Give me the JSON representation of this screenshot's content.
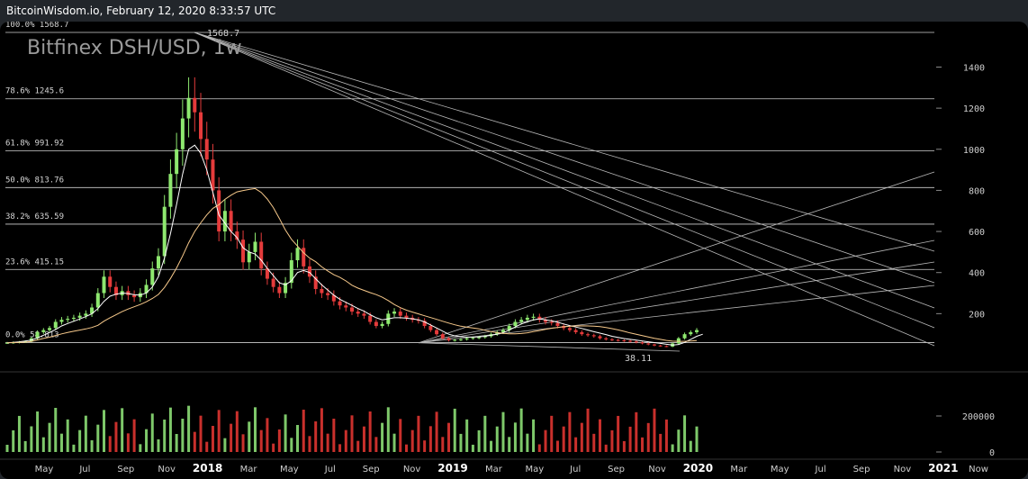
{
  "header": {
    "title": "BitcoinWisdom.io, February 12, 2020 8:33:57 UTC"
  },
  "colors": {
    "up": "#8ee86f",
    "down": "#e53b3b",
    "ema_fast": "#ffffff",
    "ema_slow": "#f7c98b",
    "grid": "#cfcfcf",
    "fan": "#b8b8b8",
    "volume_up": "#7ec86a",
    "volume_down": "#c9302c"
  },
  "chart_data": {
    "type": "candlestick",
    "title": "Bitfinex DSH/USD, 1w",
    "x_ticks": [
      "May",
      "Jul",
      "Sep",
      "Nov",
      "2018",
      "Mar",
      "May",
      "Jul",
      "Sep",
      "Nov",
      "2019",
      "Mar",
      "May",
      "Jul",
      "Sep",
      "Nov",
      "2020",
      "Mar",
      "May",
      "Jul",
      "Sep",
      "Nov",
      "2021",
      "Now"
    ],
    "x_ticks_bold": [
      "2018",
      "2019",
      "2020",
      "2021"
    ],
    "price_axis": {
      "ticks": [
        1400,
        1200,
        1000,
        800,
        600,
        400,
        200
      ],
      "range": [
        0,
        1568.7
      ]
    },
    "volume_axis": {
      "ticks": [
        200000,
        0
      ],
      "labels": [
        "200000",
        "0"
      ]
    },
    "fib_levels": [
      {
        "label": "100.0% 1568.7",
        "value": 1568.7
      },
      {
        "label": "78.6% 1245.6",
        "value": 1245.6
      },
      {
        "label": "61.8% 991.92",
        "value": 991.92
      },
      {
        "label": "50.0% 813.76",
        "value": 813.76
      },
      {
        "label": "38.2% 635.59",
        "value": 635.59
      },
      {
        "label": "23.6% 415.15",
        "value": 415.15
      },
      {
        "label": "0.0% 58.813",
        "value": 58.813
      }
    ],
    "annotations": {
      "high": "1568.7",
      "low": "38.11"
    },
    "close_series": [
      58,
      60,
      62,
      65,
      80,
      110,
      120,
      130,
      160,
      170,
      175,
      180,
      190,
      200,
      230,
      300,
      380,
      330,
      290,
      310,
      290,
      280,
      300,
      340,
      420,
      480,
      720,
      880,
      1000,
      1150,
      1250,
      1180,
      1050,
      950,
      800,
      600,
      700,
      600,
      560,
      450,
      500,
      550,
      420,
      370,
      330,
      300,
      350,
      460,
      520,
      430,
      380,
      320,
      300,
      290,
      260,
      240,
      230,
      210,
      200,
      190,
      160,
      140,
      150,
      200,
      210,
      190,
      180,
      170,
      165,
      140,
      120,
      100,
      80,
      70,
      72,
      75,
      80,
      82,
      85,
      90,
      100,
      110,
      120,
      140,
      160,
      170,
      180,
      185,
      170,
      160,
      155,
      140,
      130,
      120,
      110,
      100,
      95,
      90,
      80,
      75,
      72,
      70,
      68,
      65,
      60,
      55,
      50,
      45,
      42,
      40,
      55,
      80,
      100,
      110,
      120
    ],
    "ema_fast": [
      58,
      60,
      63,
      67,
      72,
      82,
      95,
      108,
      123,
      140,
      152,
      163,
      174,
      186,
      200,
      225,
      260,
      285,
      295,
      300,
      298,
      292,
      290,
      300,
      330,
      380,
      470,
      590,
      730,
      880,
      1000,
      1020,
      980,
      900,
      790,
      680,
      640,
      600,
      570,
      520,
      500,
      490,
      460,
      420,
      385,
      350,
      340,
      360,
      400,
      410,
      400,
      370,
      340,
      315,
      290,
      270,
      255,
      240,
      225,
      212,
      195,
      180,
      170,
      175,
      180,
      180,
      178,
      175,
      170,
      160,
      145,
      130,
      115,
      100,
      92,
      88,
      86,
      86,
      87,
      90,
      95,
      100,
      108,
      120,
      135,
      150,
      160,
      170,
      175,
      170,
      165,
      158,
      150,
      142,
      135,
      128,
      120,
      112,
      105,
      98,
      90,
      84,
      79,
      75,
      71,
      67,
      63,
      59,
      55,
      51,
      47,
      50,
      60,
      75,
      90,
      100
    ]
  }
}
